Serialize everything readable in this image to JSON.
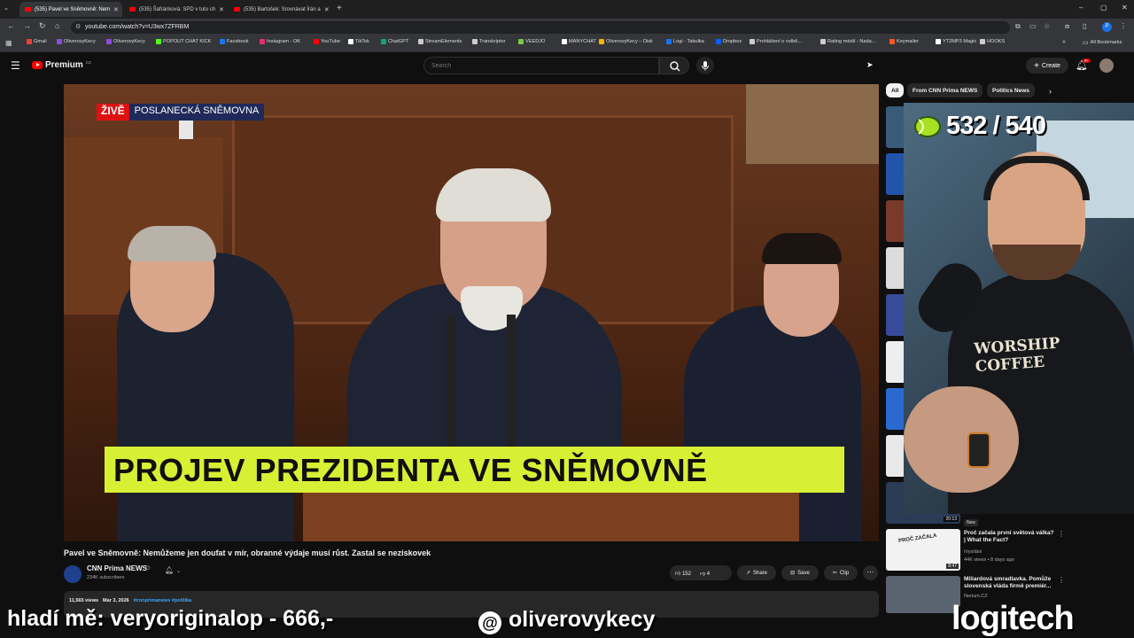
{
  "browser": {
    "tabs": [
      {
        "title": "(535) Pavel ve Sněmovně: Nem",
        "active": true
      },
      {
        "title": "(535) Šafránková: SPD v tuto ch",
        "active": false
      },
      {
        "title": "(535) Bartošek: Srovnávat Írán a",
        "active": false
      }
    ],
    "url": "youtube.com/watch?v=U3wx7ZFRBM",
    "bookmarks": [
      "Gmail",
      "OliverovyKecy",
      "OliverovyKecy",
      "POPOUT CHAT KICK",
      "Facebook",
      "Instagram - OK",
      "YouTube",
      "TikTok",
      "ChatGPT",
      "StreamElements",
      "Transkriptor",
      "VEEDJO",
      "MANYCHAT",
      "OliverovyKecy – Disk",
      "Logi - Tabulka",
      "Dropbox",
      "Prohlášení o volbě...",
      "Rating médií - Nada...",
      "Keymailer",
      "YT2MP3 Magic",
      "HOOKS"
    ],
    "all_bookmarks": "All Bookmarks",
    "bookmark_colors": [
      "#ea4335",
      "#8a4fd8",
      "#8a4fd8",
      "#53fc18",
      "#1877f2",
      "#e1306c",
      "#ff0000",
      "#ffffff",
      "#10a37f",
      "#cccccc",
      "#cccccc",
      "#7ac943",
      "#ffffff",
      "#f4b400",
      "#1a73e8",
      "#0061ff",
      "#cccccc",
      "#cccccc",
      "#ff5722",
      "#ffffff",
      "#cccccc"
    ]
  },
  "youtube": {
    "logo_text": "Premium",
    "logo_sup": "CZ",
    "search_placeholder": "Search",
    "create_label": "Create",
    "notif_badge": "9+",
    "chips": [
      "All",
      "From CNN Prima NEWS",
      "Politics News"
    ]
  },
  "video": {
    "live_tag": "ŽIVĚ",
    "live_channel": "POSLANECKÁ SNĚMOVNA",
    "lower_third": "PROJEV PREZIDENTA VE SNĚMOVNĚ",
    "title": "Pavel ve Sněmovně: Nemůžeme jen doufat v mír, obranné výdaje musí růst. Zastal se neziskovek",
    "channel_name": "CNN Prima NEWS",
    "subscribers": "234K subscribers",
    "likes": "152",
    "dislikes": "4",
    "share_label": "Share",
    "save_label": "Save",
    "clip_label": "Clip",
    "views": "11,565 views",
    "date": "Mar 3, 2026",
    "hashtags": "#cnnprimanews #politika"
  },
  "sidebar_items": [
    {
      "duration": "20:13",
      "title": "",
      "meta": "",
      "badge": ""
    },
    {
      "duration": "",
      "title": "",
      "meta": "",
      "badge": "New"
    },
    {
      "duration": "8:47",
      "title": "Proč začala první světová válka? | What the Fact?",
      "meta": "iVysílání",
      "views": "44K views • 8 days ago",
      "badge": ""
    },
    {
      "duration": "",
      "title": "Miliardová smradlavka. Pomůže slovenská vláda firmě premiér...",
      "meta": "Nerium.CZ",
      "views": "",
      "badge": ""
    }
  ],
  "overlay": {
    "score": "532 / 540",
    "left_text": "hladí mě: veryoriginalop - 666,-",
    "handle": "oliverovykecy",
    "sponsor": "logitech",
    "shirt_text": "WORSHIP COFFEE"
  }
}
